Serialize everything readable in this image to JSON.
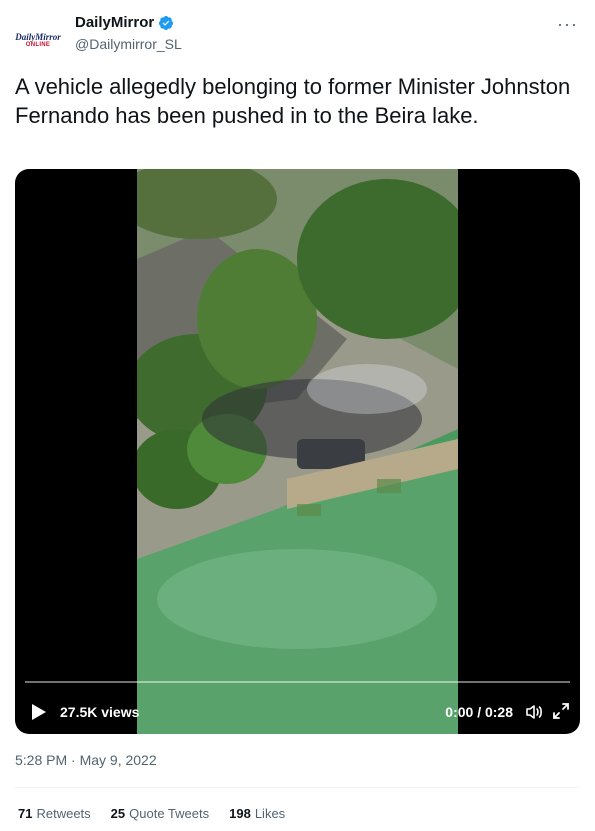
{
  "account": {
    "name": "DailyMirror",
    "handle": "@Dailymirror_SL",
    "logo_line1": "DailyMirror",
    "logo_line2": "ONLINE",
    "verified": true
  },
  "tweet": {
    "text": "A vehicle allegedly belonging to former Minister Johnston Fernando has been pushed in to the Beira lake.",
    "timestamp": "5:28 PM · May 9, 2022"
  },
  "video": {
    "views": "27.5K views",
    "time": "0:00 / 0:28",
    "progress": 0
  },
  "stats": [
    {
      "count": "71",
      "label": "Retweets"
    },
    {
      "count": "25",
      "label": "Quote Tweets"
    },
    {
      "count": "198",
      "label": "Likes"
    }
  ],
  "colors": {
    "verified_blue": "#1d9bf0",
    "secondary_text": "#536471",
    "lake_green": "#4a9a5f"
  }
}
